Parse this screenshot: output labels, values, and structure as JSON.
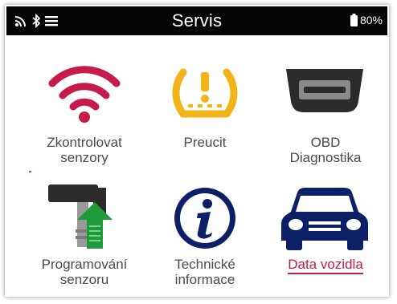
{
  "status_bar": {
    "title": "Servis",
    "battery_text": "80%",
    "icons": [
      "wifi-icon",
      "bluetooth-icon",
      "menu-icon",
      "battery-icon"
    ]
  },
  "tiles": [
    {
      "label_line1": "Zkontrolovat",
      "label_line2": "senzory",
      "icon": "wifi-sensor-icon"
    },
    {
      "label_line1": "Preucit",
      "label_line2": "",
      "icon": "tire-pressure-warning-icon"
    },
    {
      "label_line1": "OBD",
      "label_line2": "Diagnostika",
      "icon": "obd-connector-icon"
    },
    {
      "label_line1": "Programování",
      "label_line2": "senzoru",
      "icon": "sensor-program-icon"
    },
    {
      "label_line1": "Technické",
      "label_line2": "informace",
      "icon": "info-icon"
    },
    {
      "label_line1": "Data vozidla",
      "label_line2": "",
      "icon": "car-icon"
    }
  ],
  "colors": {
    "accent": "#c51a4a",
    "warning": "#f2b418",
    "navy": "#0d1f66",
    "dark": "#2b2b2b",
    "green": "#1f9a3a"
  }
}
